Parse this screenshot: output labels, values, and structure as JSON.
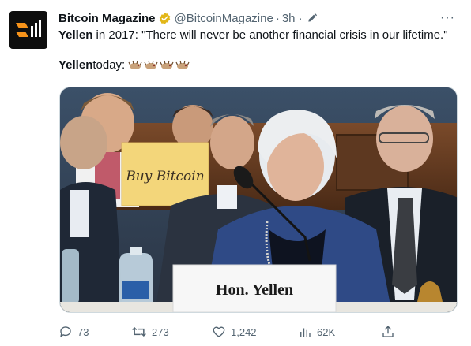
{
  "account": {
    "name": "Bitcoin Magazine",
    "handle": "@BitcoinMagazine",
    "separator": "·",
    "time": "3h ·",
    "more": "···",
    "verified": "gold-verified-badge-icon",
    "avatar": "bitcoin-magazine-logo"
  },
  "tweet": {
    "line1_name": "Yellen",
    "line1_text": " in 2017: \"There will never be another financial crisis in our lifetime.\"",
    "line2_name": "Yellen",
    "line2_text": " today:",
    "emoji": [
      "clown-icon",
      "clown-icon",
      "clown-icon",
      "clown-icon"
    ]
  },
  "media": {
    "nameplate": "Hon. Yellen",
    "sign": "Buy Bitcoin"
  },
  "actions": {
    "replies": "73",
    "retweets": "273",
    "likes": "1,242",
    "views": "62K"
  },
  "colors": {
    "text": "#0f1419",
    "muted": "#536471",
    "verified_gold": "#e2b719",
    "border": "#cfd9de"
  }
}
